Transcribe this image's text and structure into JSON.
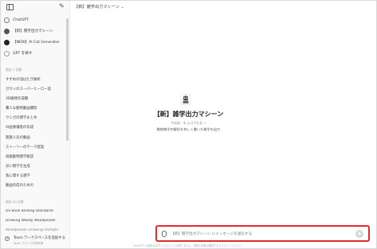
{
  "header": {
    "title": "【新】雑学出力マシーン ⌄"
  },
  "sidebar": {
    "gpts": [
      {
        "label": "ChatGPT",
        "icon": "chatgpt-icon"
      },
      {
        "label": "【新】雑学出力マシーン",
        "icon": "robot-avatar-icon"
      },
      {
        "label": "【NEW】AI Cat Generator",
        "icon": "cat-avatar-icon"
      },
      {
        "label": "GPT を探す",
        "icon": "grid-icon"
      }
    ],
    "section_7days": "過去 7 日間",
    "recent_chats": [
      "すずめの羽ばたき解析",
      "ガウンのスーパーヒーロー話",
      "3D植物作成機",
      "驚人な動物動画撮影",
      "ウミガの雑学まとめ",
      "AI画像講座の作成",
      "雑貨人気の動画",
      "ストーリーのテーマ提案",
      "高級動物雑学解説",
      "深い雑学を生成",
      "角に関する雑学",
      "動画作成のための"
    ],
    "section_30days": "過去 30 日間",
    "older_chats": [
      "US Book Binding Standards",
      "Drawing Woody Woodpecker",
      "Woodpecker Drawing Prompts"
    ],
    "team_upgrade": "Team ワークスペースを追加する",
    "team_upgrade_sub": "Team プランで共同作業"
  },
  "main": {
    "gpt_title": "【新】雑学出力マシーン",
    "author": "作成者：朱 まき子社長 ↗",
    "description": "動物雑学の解析を何しく書いた雑学を出力",
    "input_placeholder": "【新】雑学出力マシーン にメッセージを送信する",
    "footer_note": "ChatGPT の回答は必ずしも正しいとは限りません。重要な情報は確認するようにしてください。"
  }
}
